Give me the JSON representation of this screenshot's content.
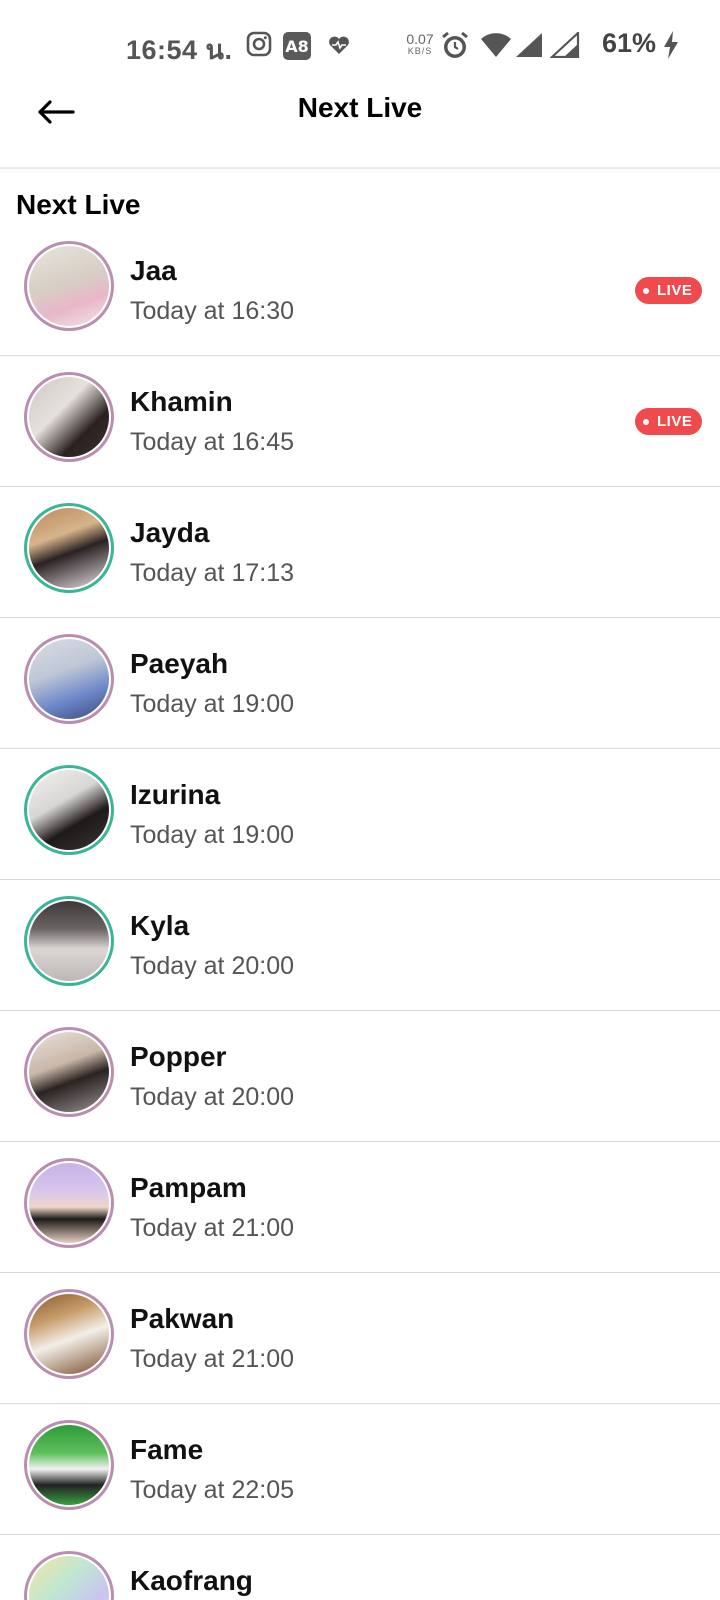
{
  "status_bar": {
    "time": "16:54 น.",
    "net_speed_value": "0.07",
    "net_speed_unit": "KB/S",
    "battery": "61%",
    "icons": [
      "instagram-icon",
      "app-icon",
      "heart-icon",
      "alarm-icon",
      "wifi-icon",
      "signal-icon",
      "signal-icon",
      "charging-icon"
    ]
  },
  "app_bar": {
    "title": "Next Live",
    "back_icon": "back-arrow-icon"
  },
  "section": {
    "title": "Next Live"
  },
  "colors": {
    "live_badge": "#ef4a4d",
    "ring_purple": "#b98fb0",
    "ring_green": "#3bb598"
  },
  "live_label": "LIVE",
  "items": [
    {
      "name": "Jaa",
      "time": "Today at 16:30",
      "live": true,
      "ring": "purple",
      "avatar": "linear-gradient(160deg,#e9e4dc 0%,#d7cfc6 45%,#e8b7c8 70%,#f1e6ea 100%)"
    },
    {
      "name": "Khamin",
      "time": "Today at 16:45",
      "live": true,
      "ring": "purple",
      "avatar": "linear-gradient(135deg,#cfc8c4 0%,#e6e1dc 40%,#2b2220 70%,#3b302c 100%)"
    },
    {
      "name": "Jayda",
      "time": "Today at 17:13",
      "live": false,
      "ring": "green",
      "avatar": "linear-gradient(160deg,#b88a5c 0%,#d6b48a 35%,#2a2222 55%,#e9dfe6 100%)"
    },
    {
      "name": "Paeyah",
      "time": "Today at 19:00",
      "live": false,
      "ring": "purple",
      "avatar": "linear-gradient(160deg,#d8dde6 0%,#bfc7d6 40%,#6b86c8 70%,#3a4a7a 100%)"
    },
    {
      "name": "Izurina",
      "time": "Today at 19:00",
      "live": false,
      "ring": "green",
      "avatar": "linear-gradient(150deg,#f2f2f2 0%,#d8d6d4 40%,#1e1a1a 65%,#3a3434 100%)"
    },
    {
      "name": "Kyla",
      "time": "Today at 20:00",
      "live": false,
      "ring": "green",
      "avatar": "linear-gradient(180deg,#3e3838 0%,#6a6464 35%,#d9d6d4 60%,#bdb8b6 100%)"
    },
    {
      "name": "Popper",
      "time": "Today at 20:00",
      "live": false,
      "ring": "purple",
      "avatar": "linear-gradient(160deg,#e8e2dc 0%,#c9b7a8 40%,#2b2322 60%,#9a9494 100%)"
    },
    {
      "name": "Pampam",
      "time": "Today at 21:00",
      "live": false,
      "ring": "purple",
      "avatar": "linear-gradient(180deg,#c9b2e6 0%,#d8c5ee 35%,#f0d6c8 55%,#1c1a1a 70%,#e8cfc0 100%)"
    },
    {
      "name": "Pakwan",
      "time": "Today at 21:00",
      "live": false,
      "ring": "purple",
      "avatar": "linear-gradient(160deg,#8a5a30 0%,#c79b68 30%,#f2efe8 55%,#7a4b2a 100%)"
    },
    {
      "name": "Fame",
      "time": "Today at 22:05",
      "live": false,
      "ring": "purple",
      "avatar": "linear-gradient(180deg,#2f9a3a 0%,#5cc05a 35%,#f2f2f2 55%,#222 75%,#3aa040 100%)"
    },
    {
      "name": "Kaofrang",
      "time": "",
      "live": false,
      "ring": "purple",
      "avatar": "linear-gradient(135deg,#f3e7a8 0%,#bfe6d2 40%,#c9c5f0 70%,#f0d0e4 100%)"
    }
  ]
}
